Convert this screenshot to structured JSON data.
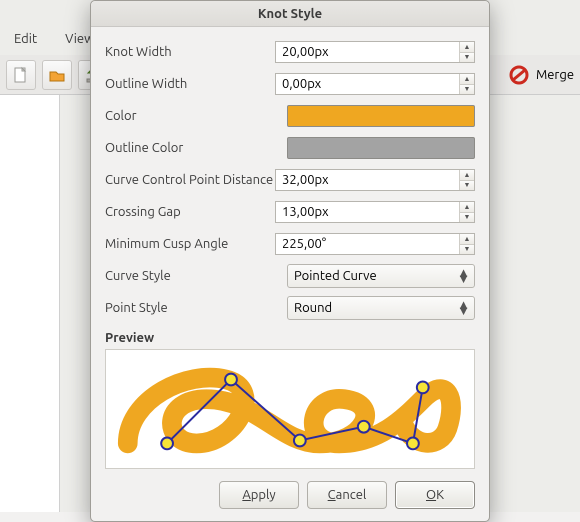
{
  "background": {
    "menu": {
      "edit": "Edit",
      "view": "View"
    },
    "merge_label": "Merge"
  },
  "dialog": {
    "title": "Knot Style",
    "fields": {
      "knot_width": {
        "label": "Knot Width",
        "value": "20,00px"
      },
      "outline_width": {
        "label": "Outline Width",
        "value": "0,00px"
      },
      "color": {
        "label": "Color",
        "value": "#efa721"
      },
      "outline_color": {
        "label": "Outline Color",
        "value": "#a3a3a3"
      },
      "curve_ctrl_dist": {
        "label": "Curve Control Point Distance",
        "value": "32,00px"
      },
      "crossing_gap": {
        "label": "Crossing Gap",
        "value": "13,00px"
      },
      "min_cusp_angle": {
        "label": "Minimum Cusp Angle",
        "value": "225,00°"
      },
      "curve_style": {
        "label": "Curve Style",
        "value": "Pointed Curve"
      },
      "point_style": {
        "label": "Point Style",
        "value": "Round"
      }
    },
    "preview_label": "Preview",
    "buttons": {
      "apply": "Apply",
      "cancel": "Cancel",
      "ok": "OK"
    }
  }
}
